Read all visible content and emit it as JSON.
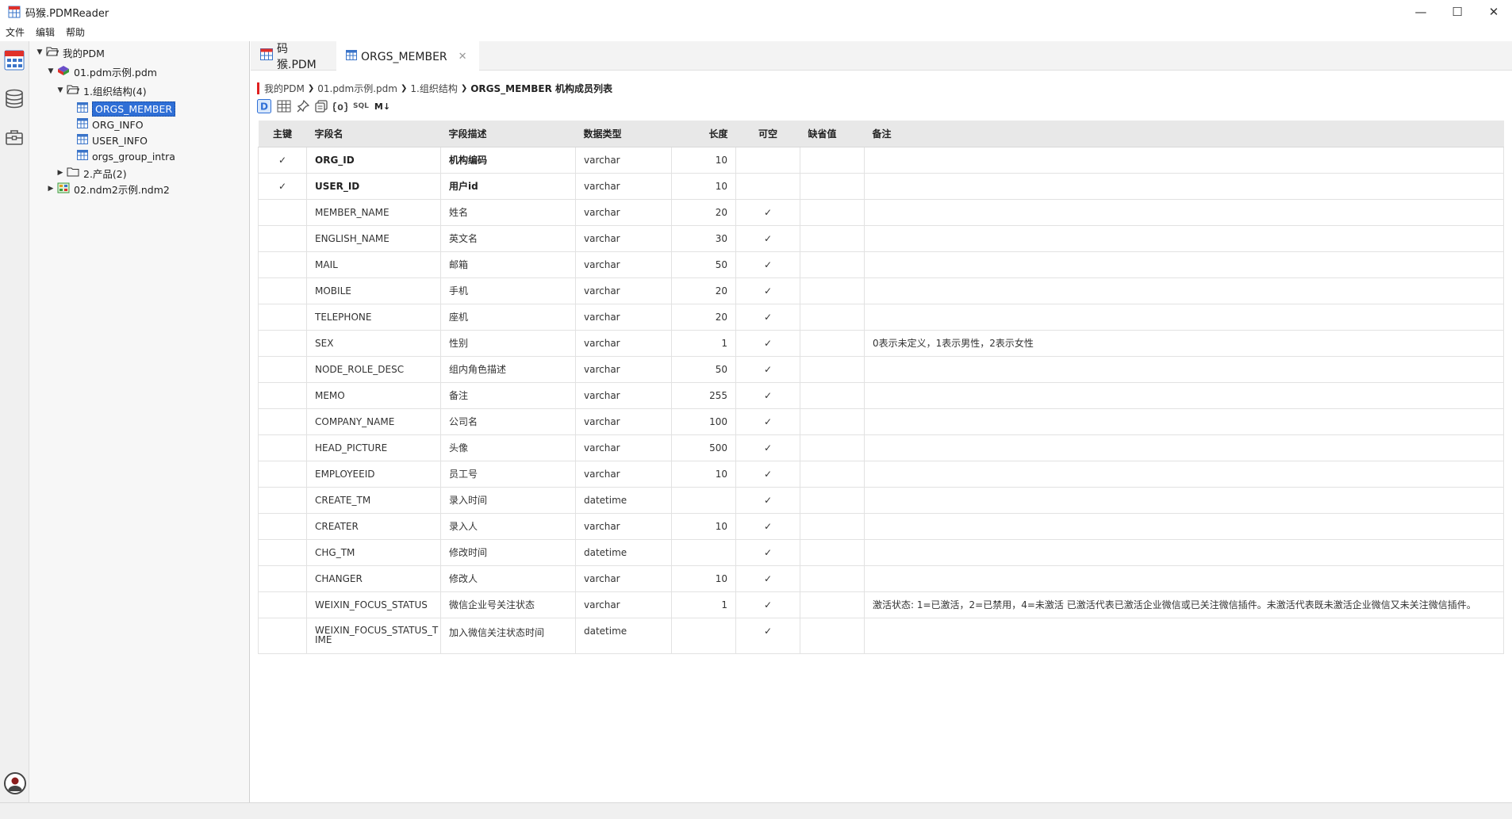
{
  "window": {
    "title": "码猴.PDMReader",
    "controls": {
      "minimize": "—",
      "maximize": "☐",
      "close": "✕"
    }
  },
  "menu": [
    "文件",
    "编辑",
    "帮助"
  ],
  "activity": {
    "items": [
      "pdm-icon",
      "database-icon",
      "toolbox-icon"
    ],
    "avatar": "user-avatar"
  },
  "tree": {
    "root": "我的PDM",
    "file1": "01.pdm示例.pdm",
    "folder1": "1.组织结构(4)",
    "tables": [
      "ORGS_MEMBER",
      "ORG_INFO",
      "USER_INFO",
      "orgs_group_intra"
    ],
    "folder2": "2.产品(2)",
    "file2": "02.ndm2示例.ndm2"
  },
  "tabs": [
    {
      "label": "码猴.PDM"
    },
    {
      "label": "ORGS_MEMBER",
      "close": "✕"
    }
  ],
  "breadcrumb": {
    "items": [
      "我的PDM",
      "01.pdm示例.pdm",
      "1.组织结构"
    ],
    "current": "ORGS_MEMBER 机构成员列表"
  },
  "toolbar": {
    "sql_label": "SQL",
    "md_label": "M↓"
  },
  "table": {
    "headers": [
      "主键",
      "字段名",
      "字段描述",
      "数据类型",
      "长度",
      "可空",
      "缺省值",
      "备注"
    ],
    "rows": [
      {
        "pk": "✓",
        "name": "ORG_ID",
        "desc": "机构编码",
        "type": "varchar",
        "len": "10",
        "nullable": "",
        "default": "",
        "note": ""
      },
      {
        "pk": "✓",
        "name": "USER_ID",
        "desc": "用户id",
        "type": "varchar",
        "len": "10",
        "nullable": "",
        "default": "",
        "note": ""
      },
      {
        "pk": "",
        "name": "MEMBER_NAME",
        "desc": "姓名",
        "type": "varchar",
        "len": "20",
        "nullable": "✓",
        "default": "",
        "note": ""
      },
      {
        "pk": "",
        "name": "ENGLISH_NAME",
        "desc": "英文名",
        "type": "varchar",
        "len": "30",
        "nullable": "✓",
        "default": "",
        "note": ""
      },
      {
        "pk": "",
        "name": "MAIL",
        "desc": "邮箱",
        "type": "varchar",
        "len": "50",
        "nullable": "✓",
        "default": "",
        "note": ""
      },
      {
        "pk": "",
        "name": "MOBILE",
        "desc": "手机",
        "type": "varchar",
        "len": "20",
        "nullable": "✓",
        "default": "",
        "note": ""
      },
      {
        "pk": "",
        "name": "TELEPHONE",
        "desc": "座机",
        "type": "varchar",
        "len": "20",
        "nullable": "✓",
        "default": "",
        "note": ""
      },
      {
        "pk": "",
        "name": "SEX",
        "desc": "性别",
        "type": "varchar",
        "len": "1",
        "nullable": "✓",
        "default": "",
        "note": "0表示未定义，1表示男性，2表示女性"
      },
      {
        "pk": "",
        "name": "NODE_ROLE_DESC",
        "desc": "组内角色描述",
        "type": "varchar",
        "len": "50",
        "nullable": "✓",
        "default": "",
        "note": ""
      },
      {
        "pk": "",
        "name": "MEMO",
        "desc": "备注",
        "type": "varchar",
        "len": "255",
        "nullable": "✓",
        "default": "",
        "note": ""
      },
      {
        "pk": "",
        "name": "COMPANY_NAME",
        "desc": "公司名",
        "type": "varchar",
        "len": "100",
        "nullable": "✓",
        "default": "",
        "note": ""
      },
      {
        "pk": "",
        "name": "HEAD_PICTURE",
        "desc": "头像",
        "type": "varchar",
        "len": "500",
        "nullable": "✓",
        "default": "",
        "note": ""
      },
      {
        "pk": "",
        "name": "EMPLOYEEID",
        "desc": "员工号",
        "type": "varchar",
        "len": "10",
        "nullable": "✓",
        "default": "",
        "note": ""
      },
      {
        "pk": "",
        "name": "CREATE_TM",
        "desc": "录入时间",
        "type": "datetime",
        "len": "",
        "nullable": "✓",
        "default": "",
        "note": ""
      },
      {
        "pk": "",
        "name": "CREATER",
        "desc": "录入人",
        "type": "varchar",
        "len": "10",
        "nullable": "✓",
        "default": "",
        "note": ""
      },
      {
        "pk": "",
        "name": "CHG_TM",
        "desc": "修改时间",
        "type": "datetime",
        "len": "",
        "nullable": "✓",
        "default": "",
        "note": ""
      },
      {
        "pk": "",
        "name": "CHANGER",
        "desc": "修改人",
        "type": "varchar",
        "len": "10",
        "nullable": "✓",
        "default": "",
        "note": ""
      },
      {
        "pk": "",
        "name": "WEIXIN_FOCUS_STATUS",
        "desc": "微信企业号关注状态",
        "type": "varchar",
        "len": "1",
        "nullable": "✓",
        "default": "",
        "note": "激活状态: 1=已激活，2=已禁用，4=未激活 已激活代表已激活企业微信或已关注微信插件。未激活代表既未激活企业微信又未关注微信插件。"
      },
      {
        "pk": "",
        "name": "WEIXIN_FOCUS_STATUS_TIME",
        "desc": "加入微信关注状态时间",
        "type": "datetime",
        "len": "",
        "nullable": "✓",
        "default": "",
        "note": ""
      }
    ]
  }
}
